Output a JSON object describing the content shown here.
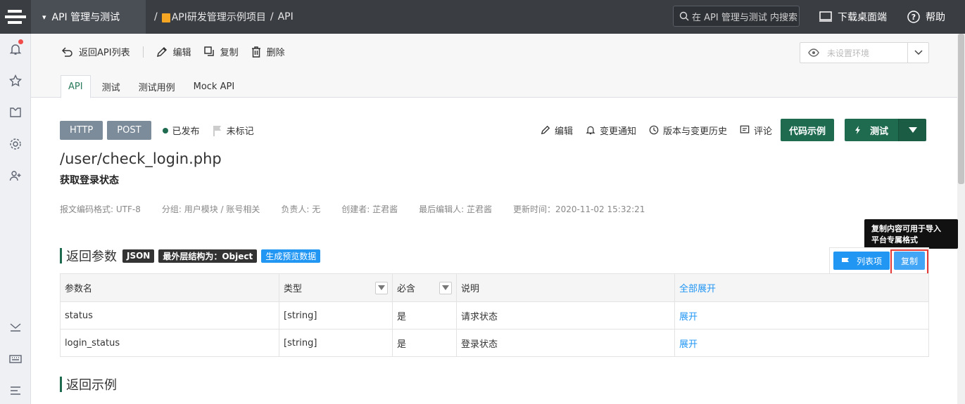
{
  "topbar": {
    "module": "API 管理与测试",
    "breadcrumb": [
      "API研发管理示例项目",
      "API"
    ],
    "search_placeholder": "在 API 管理与测试 内搜索",
    "download": "下载桌面端",
    "help": "帮助"
  },
  "toolbar": {
    "back": "返回API列表",
    "edit": "编辑",
    "copy": "复制",
    "delete": "删除",
    "env_placeholder": "未设置环境"
  },
  "tabs": [
    "API",
    "测试",
    "测试用例",
    "Mock API"
  ],
  "api": {
    "protocol": "HTTP",
    "method": "POST",
    "status": "已发布",
    "mark": "未标记",
    "path": "/user/check_login.php",
    "name": "获取登录状态"
  },
  "actions": {
    "edit": "编辑",
    "notify": "变更通知",
    "history": "版本与变更历史",
    "comment": "评论",
    "code_example": "代码示例",
    "test": "测试"
  },
  "meta": {
    "encoding": "报文编码格式: UTF-8",
    "group": "分组: 用户模块 / 账号相关",
    "owner": "负责人: 无",
    "creator": "创建者: 芷君酱",
    "last_editor": "最后编辑人: 芷君酱",
    "updated": "更新时间：2020-11-02 15:32:21"
  },
  "return_params": {
    "title": "返回参数",
    "tag_json": "JSON",
    "tag_outer": "最外层结构为：Object",
    "tag_preview": "生成预览数据",
    "tooltip_line1": "复制内容可用于导入",
    "tooltip_line2": "平台专属格式",
    "list_btn": "列表项",
    "copy_btn": "复制",
    "headers": [
      "参数名",
      "类型",
      "必含",
      "说明",
      "全部展开"
    ],
    "rows": [
      {
        "name": "status",
        "type": "[string]",
        "required": "是",
        "desc": "请求状态",
        "action": "展开"
      },
      {
        "name": "login_status",
        "type": "[string]",
        "required": "是",
        "desc": "登录状态",
        "action": "展开"
      }
    ]
  },
  "return_example": {
    "title": "返回示例"
  }
}
